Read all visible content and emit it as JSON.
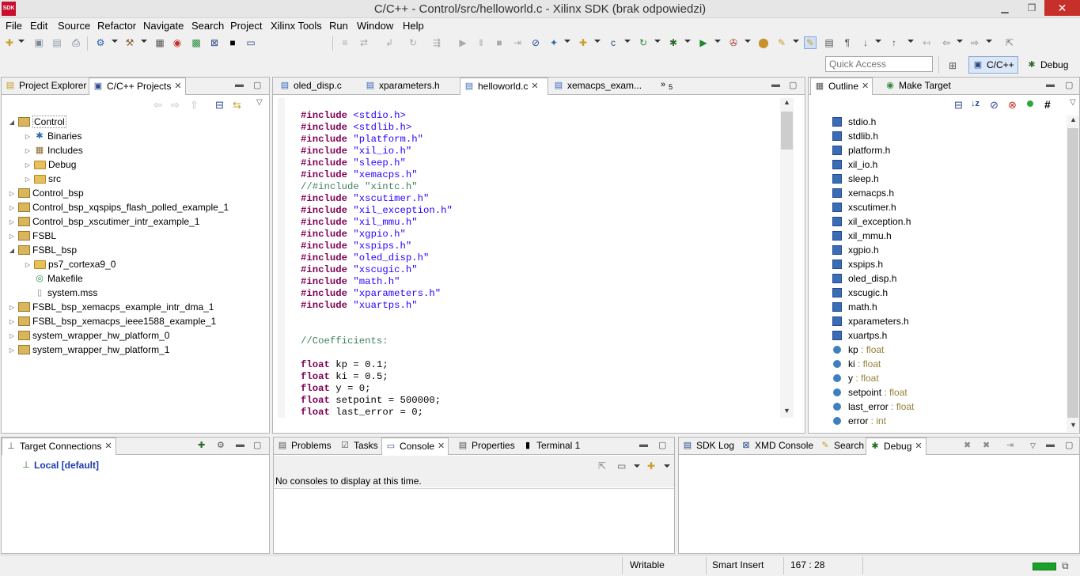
{
  "window": {
    "title": "C/C++ - Control/src/helloworld.c - Xilinx SDK (brak odpowiedzi)",
    "icon_text": "SDK"
  },
  "menu": [
    "File",
    "Edit",
    "Source",
    "Refactor",
    "Navigate",
    "Search",
    "Project",
    "Xilinx Tools",
    "Run",
    "Window",
    "Help"
  ],
  "quick_access": {
    "placeholder": "Quick Access"
  },
  "perspectives": {
    "cpp": "C/C++",
    "debug": "Debug"
  },
  "left_panel": {
    "tabs": [
      "Project Explorer",
      "C/C++ Projects"
    ],
    "tree": [
      {
        "label": "Control",
        "level": 0,
        "expanded": true,
        "type": "project"
      },
      {
        "label": "Binaries",
        "level": 1,
        "expanded": false,
        "type": "binaries"
      },
      {
        "label": "Includes",
        "level": 1,
        "expanded": false,
        "type": "includes"
      },
      {
        "label": "Debug",
        "level": 1,
        "expanded": false,
        "type": "folder"
      },
      {
        "label": "src",
        "level": 1,
        "expanded": false,
        "type": "folder"
      },
      {
        "label": "Control_bsp",
        "level": 0,
        "expanded": false,
        "type": "project"
      },
      {
        "label": "Control_bsp_xqspips_flash_polled_example_1",
        "level": 0,
        "expanded": false,
        "type": "project"
      },
      {
        "label": "Control_bsp_xscutimer_intr_example_1",
        "level": 0,
        "expanded": false,
        "type": "project"
      },
      {
        "label": "FSBL",
        "level": 0,
        "expanded": false,
        "type": "project"
      },
      {
        "label": "FSBL_bsp",
        "level": 0,
        "expanded": true,
        "type": "project"
      },
      {
        "label": "ps7_cortexa9_0",
        "level": 1,
        "expanded": false,
        "type": "folder"
      },
      {
        "label": "Makefile",
        "level": 1,
        "expanded": null,
        "type": "makefile"
      },
      {
        "label": "system.mss",
        "level": 1,
        "expanded": null,
        "type": "file"
      },
      {
        "label": "FSBL_bsp_xemacps_example_intr_dma_1",
        "level": 0,
        "expanded": false,
        "type": "project"
      },
      {
        "label": "FSBL_bsp_xemacps_ieee1588_example_1",
        "level": 0,
        "expanded": false,
        "type": "project"
      },
      {
        "label": "system_wrapper_hw_platform_0",
        "level": 0,
        "expanded": false,
        "type": "project"
      },
      {
        "label": "system_wrapper_hw_platform_1",
        "level": 0,
        "expanded": false,
        "type": "project"
      }
    ]
  },
  "editor": {
    "tabs": [
      "oled_disp.c",
      "xparameters.h",
      "helloworld.c",
      "xemacps_exam..."
    ],
    "overflow": "5",
    "lines": [
      {
        "k": "#include",
        "v": " <stdio.h>"
      },
      {
        "k": "#include",
        "v": " <stdlib.h>"
      },
      {
        "k": "#include",
        "v": " \"platform.h\""
      },
      {
        "k": "#include",
        "v": " \"xil_io.h\""
      },
      {
        "k": "#include",
        "v": " \"sleep.h\""
      },
      {
        "k": "#include",
        "v": " \"xemacps.h\""
      },
      {
        "c": "//#include \"xintc.h\""
      },
      {
        "k": "#include",
        "v": " \"xscutimer.h\""
      },
      {
        "k": "#include",
        "v": " \"xil_exception.h\""
      },
      {
        "k": "#include",
        "v": " \"xil_mmu.h\""
      },
      {
        "k": "#include",
        "v": " \"xgpio.h\""
      },
      {
        "k": "#include",
        "v": " \"xspips.h\""
      },
      {
        "k": "#include",
        "v": " \"oled_disp.h\""
      },
      {
        "k": "#include",
        "v": " \"xscugic.h\""
      },
      {
        "k": "#include",
        "v": " \"math.h\""
      },
      {
        "k": "#include",
        "v": " \"xparameters.h\""
      },
      {
        "k": "#include",
        "v": " \"xuartps.h\""
      },
      {
        "t": ""
      },
      {
        "t": ""
      },
      {
        "c": "//Coefficients:"
      },
      {
        "t": ""
      },
      {
        "k": "float",
        "t": " kp = 0.1;"
      },
      {
        "k": "float",
        "t": " ki = 0.5;"
      },
      {
        "k": "float",
        "t": " y = 0;"
      },
      {
        "k": "float",
        "t": " setpoint = 500000;"
      },
      {
        "k": "float",
        "t": " last_error = 0;"
      }
    ]
  },
  "outline": {
    "tabs": [
      "Outline",
      "Make Target"
    ],
    "headers": [
      "stdio.h",
      "stdlib.h",
      "platform.h",
      "xil_io.h",
      "sleep.h",
      "xemacps.h",
      "xscutimer.h",
      "xil_exception.h",
      "xil_mmu.h",
      "xgpio.h",
      "xspips.h",
      "oled_disp.h",
      "xscugic.h",
      "math.h",
      "xparameters.h",
      "xuartps.h"
    ],
    "vars": [
      {
        "name": "kp",
        "type": " : float"
      },
      {
        "name": "ki",
        "type": " : float"
      },
      {
        "name": "y",
        "type": " : float"
      },
      {
        "name": "setpoint",
        "type": " : float"
      },
      {
        "name": "last_error",
        "type": " : float"
      },
      {
        "name": "error",
        "type": " : int"
      }
    ]
  },
  "target": {
    "tab": "Target Connections",
    "item": "Local [default]"
  },
  "console": {
    "tabs": [
      "Problems",
      "Tasks",
      "Console",
      "Properties",
      "Terminal 1"
    ],
    "message": "No consoles to display at this time."
  },
  "debug_panel": {
    "tabs": [
      "SDK Log",
      "XMD Console",
      "Search",
      "Debug"
    ]
  },
  "status": {
    "mode": "Writable",
    "insert": "Smart Insert",
    "position": "167 : 28"
  },
  "colors": {
    "keyword": "#7f0055",
    "string": "#2a00ff",
    "comment": "#3f7f5f",
    "close_button": "#c7302a"
  }
}
